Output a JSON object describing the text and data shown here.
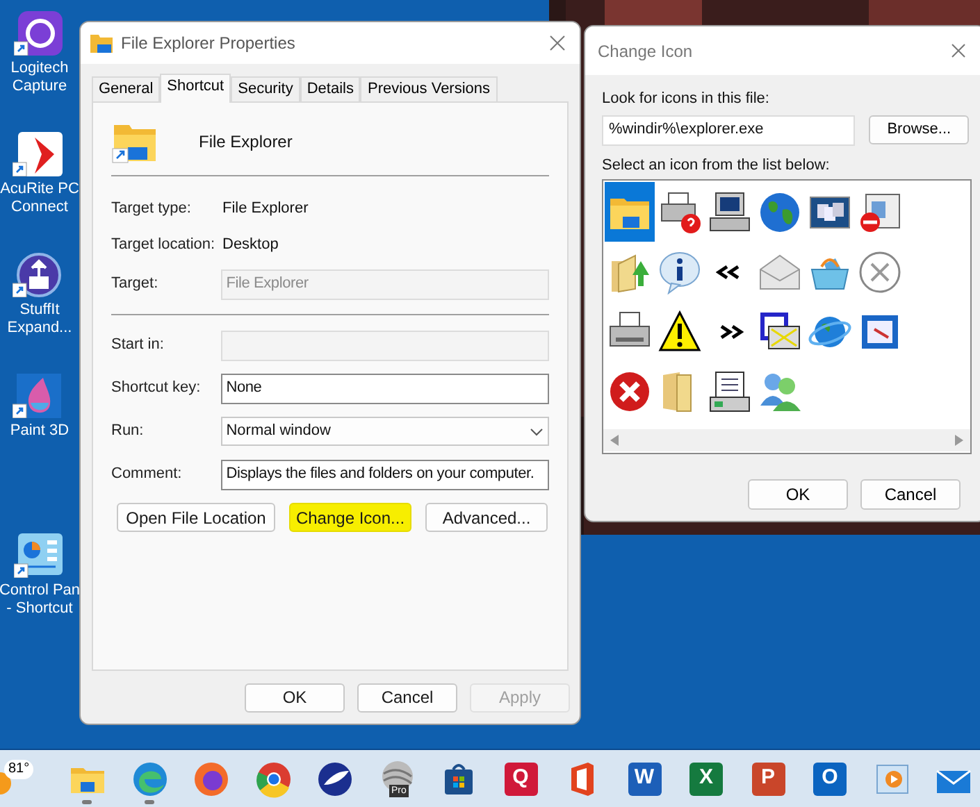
{
  "desktop_icons": [
    {
      "kind": "logitech",
      "lines": [
        "Logitech",
        "Capture"
      ]
    },
    {
      "kind": "acurite",
      "lines": [
        "AcuRite PC",
        "Connect"
      ]
    },
    {
      "kind": "stuffit",
      "lines": [
        "StuffIt",
        "Expand..."
      ]
    },
    {
      "kind": "paint3d",
      "lines": [
        "Paint 3D"
      ]
    },
    {
      "kind": "control",
      "lines": [
        "Control Pan",
        "- Shortcut"
      ]
    }
  ],
  "properties_dialog": {
    "title": "File Explorer Properties",
    "tabs": [
      {
        "label": "General",
        "selected": false
      },
      {
        "label": "Shortcut",
        "selected": true
      },
      {
        "label": "Security",
        "selected": false
      },
      {
        "label": "Details",
        "selected": false
      },
      {
        "label": "Previous Versions",
        "selected": false
      }
    ],
    "name": "File Explorer",
    "info": [
      {
        "label": "Target type:",
        "value": "File Explorer"
      },
      {
        "label": "Target location:",
        "value": "Desktop"
      }
    ],
    "target_fields": [
      {
        "label": "Target:",
        "value": "File Explorer",
        "kind": "text",
        "disabled": true
      }
    ],
    "fields": [
      {
        "label": "Start in:",
        "kind": "text",
        "disabled": true
      },
      {
        "label": "Shortcut key:",
        "value": "None",
        "kind": "text",
        "disabled": false
      },
      {
        "label": "Run:",
        "value": "Normal window",
        "kind": "select",
        "disabled": false
      },
      {
        "label": "Comment:",
        "value": "Displays the files and folders on your computer.",
        "kind": "text",
        "disabled": false
      }
    ],
    "action_buttons": [
      {
        "label": "Open File Location",
        "highlighted": false
      },
      {
        "label": "Change Icon...",
        "highlighted": true
      },
      {
        "label": "Advanced...",
        "highlighted": false
      }
    ],
    "footer_buttons": [
      {
        "label": "OK",
        "disabled": false
      },
      {
        "label": "Cancel",
        "disabled": false
      },
      {
        "label": "Apply",
        "disabled": true
      }
    ]
  },
  "change_icon_dialog": {
    "title": "Change Icon",
    "file_label": "Look for icons in this file:",
    "file_value": "%windir%\\explorer.exe",
    "browse": "Browse...",
    "list_label": "Select an icon from the list below:",
    "icons": [
      {
        "kind": "folder",
        "selected": true
      },
      {
        "kind": "printer-help",
        "selected": false
      },
      {
        "kind": "computer",
        "selected": false
      },
      {
        "kind": "globe",
        "selected": false
      },
      {
        "kind": "windows",
        "selected": false
      },
      {
        "kind": "blocked",
        "selected": false
      },
      {
        "kind": "folder-up",
        "selected": false
      },
      {
        "kind": "info",
        "selected": false
      },
      {
        "kind": "chevrons-left",
        "selected": false
      },
      {
        "kind": "envelope",
        "selected": false
      },
      {
        "kind": "basket",
        "selected": false
      },
      {
        "kind": "close-circle",
        "selected": false
      },
      {
        "kind": "printer",
        "selected": false
      },
      {
        "kind": "warning",
        "selected": false
      },
      {
        "kind": "chevrons-right",
        "selected": false
      },
      {
        "kind": "document",
        "selected": false
      },
      {
        "kind": "globe-ring",
        "selected": false
      },
      {
        "kind": "presentation",
        "selected": false
      },
      {
        "kind": "error",
        "selected": false
      },
      {
        "kind": "folder-open",
        "selected": false
      },
      {
        "kind": "server",
        "selected": false
      },
      {
        "kind": "users",
        "selected": false
      }
    ],
    "buttons": [
      "OK",
      "Cancel"
    ]
  },
  "taskbar": {
    "weather": "81°",
    "apps": [
      {
        "kind": "folder",
        "running": true
      },
      {
        "kind": "edge",
        "running": true
      },
      {
        "kind": "firefox",
        "running": false
      },
      {
        "kind": "chrome",
        "running": false
      },
      {
        "kind": "bird",
        "running": false
      },
      {
        "kind": "earth",
        "running": false,
        "badge": "Pro"
      },
      {
        "kind": "store",
        "running": false
      },
      {
        "kind": "tile",
        "color": "#d0193a",
        "letter": "Q",
        "running": false
      },
      {
        "kind": "office",
        "running": false
      },
      {
        "kind": "tile",
        "color": "#1d5fb8",
        "letter": "W",
        "running": false
      },
      {
        "kind": "tile",
        "color": "#157a3f",
        "letter": "X",
        "running": false
      },
      {
        "kind": "tile",
        "color": "#c9462a",
        "letter": "P",
        "running": false
      },
      {
        "kind": "tile",
        "color": "#0b64c0",
        "letter": "O",
        "running": false
      },
      {
        "kind": "media",
        "running": false
      },
      {
        "kind": "mail",
        "running": false
      }
    ]
  }
}
